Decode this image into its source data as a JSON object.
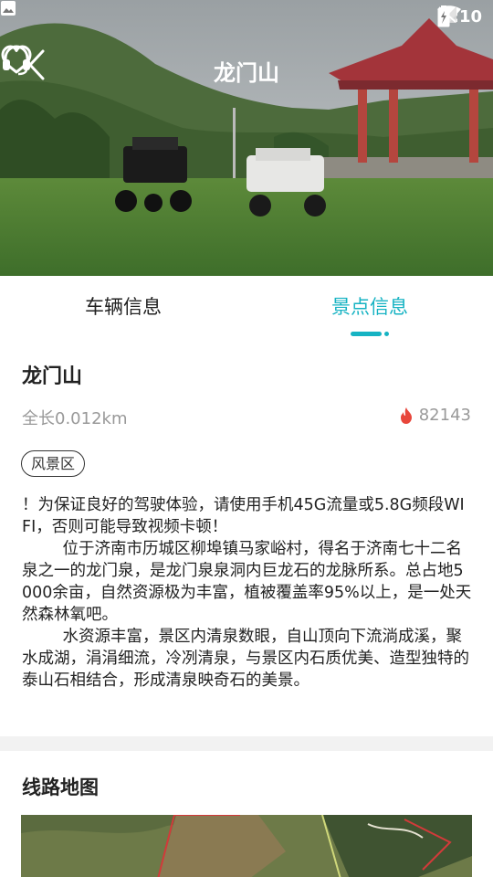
{
  "status_bar": {
    "time": "9:10",
    "icons": [
      "image-notification-icon",
      "wifi-icon",
      "no-signal-icon",
      "battery-icon"
    ]
  },
  "header": {
    "title": "龙门山",
    "back_icon": "chevron-left-icon",
    "service_icon": "headset-icon",
    "favorite_icon": "heart-icon"
  },
  "tabs": [
    {
      "label": "车辆信息",
      "active": false
    },
    {
      "label": "景点信息",
      "active": true
    }
  ],
  "spot": {
    "name": "龙门山",
    "length": "全长0.012km",
    "hot_count": "82143",
    "tag": "风景区",
    "description": "！为保证良好的驾驶体验，请使用手机45G流量或5.8G频段WIFI，否则可能导致视频卡顿！\n        位于济南市历城区柳埠镇马家峪村，得名于济南七十二名泉之一的龙门泉，是龙门泉泉洞内巨龙石的龙脉所系。总占地5000余亩，自然资源极为丰富，植被覆盖率95%以上，是一处天然森林氧吧。\n        水资源丰富，景区内清泉数眼，自山顶向下流淌成溪，聚水成湖，涓涓细流，冷冽清泉，与景区内石质优美、造型独特的泰山石相结合，形成清泉映奇石的美景。"
  },
  "route": {
    "title": "线路地图"
  },
  "colors": {
    "accent": "#16b3c3",
    "hot_icon": "#e8463b"
  }
}
